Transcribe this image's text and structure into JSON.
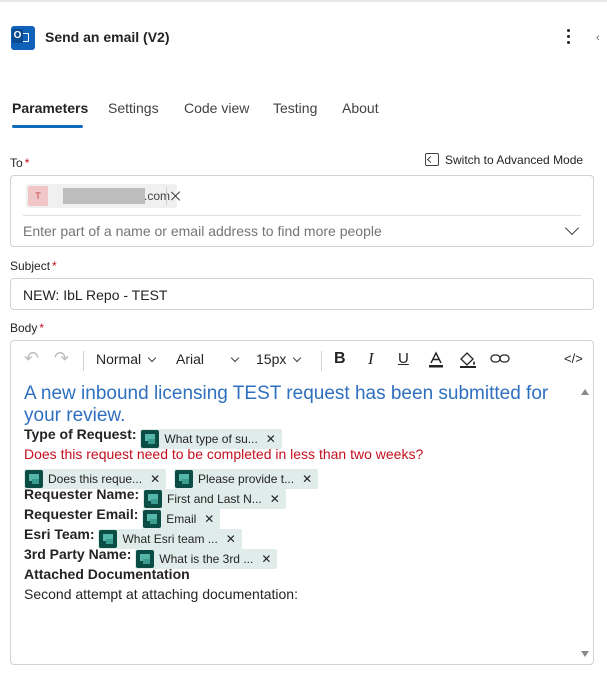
{
  "header": {
    "title": "Send an email (V2)",
    "icon": "outlook-icon"
  },
  "tabs": [
    {
      "label": "Parameters",
      "active": true
    },
    {
      "label": "Settings",
      "active": false
    },
    {
      "label": "Code view",
      "active": false
    },
    {
      "label": "Testing",
      "active": false
    },
    {
      "label": "About",
      "active": false
    }
  ],
  "to": {
    "label": "To",
    "required_mark": "*",
    "advanced_mode_label": "Switch to Advanced Mode",
    "recipient": {
      "avatar_initial": "T",
      "email_visible_suffix": ".com"
    },
    "placeholder": "Enter part of a name or email address to find more people"
  },
  "subject": {
    "label": "Subject",
    "required_mark": "*",
    "value": "NEW: IbL Repo - TEST"
  },
  "body": {
    "label": "Body",
    "required_mark": "*",
    "toolbar": {
      "paragraph_style": "Normal",
      "font": "Arial",
      "size": "15px",
      "undo": "↶",
      "redo": "↷",
      "bold": "B",
      "italic": "I",
      "underline": "U",
      "code": "</>"
    },
    "heading": "A new inbound licensing TEST request has been submitted for your review.",
    "type_of_request_label": "Type of Request:",
    "type_of_request_token": "What type of su...",
    "urgent_question": "Does this request need to be completed in less than two weeks?",
    "urgent_token_1": "Does this reque...",
    "urgent_token_2": "Please provide t...",
    "requester_name_label": "Requester Name:",
    "requester_name_token": "First and Last N...",
    "requester_email_label": "Requester Email:",
    "requester_email_token": "Email",
    "esri_team_label": "Esri Team:",
    "esri_team_token": "What Esri team ...",
    "third_party_label": "3rd Party Name:",
    "third_party_token": "What is the 3rd ...",
    "attached_label": "Attached Documentation",
    "attached_text": "Second attempt at attaching documentation:"
  },
  "colors": {
    "accent": "#0f6cbd",
    "heading_blue": "#2f6fbf",
    "required_red": "#c50f1f",
    "token_bg": "#dfecea"
  }
}
